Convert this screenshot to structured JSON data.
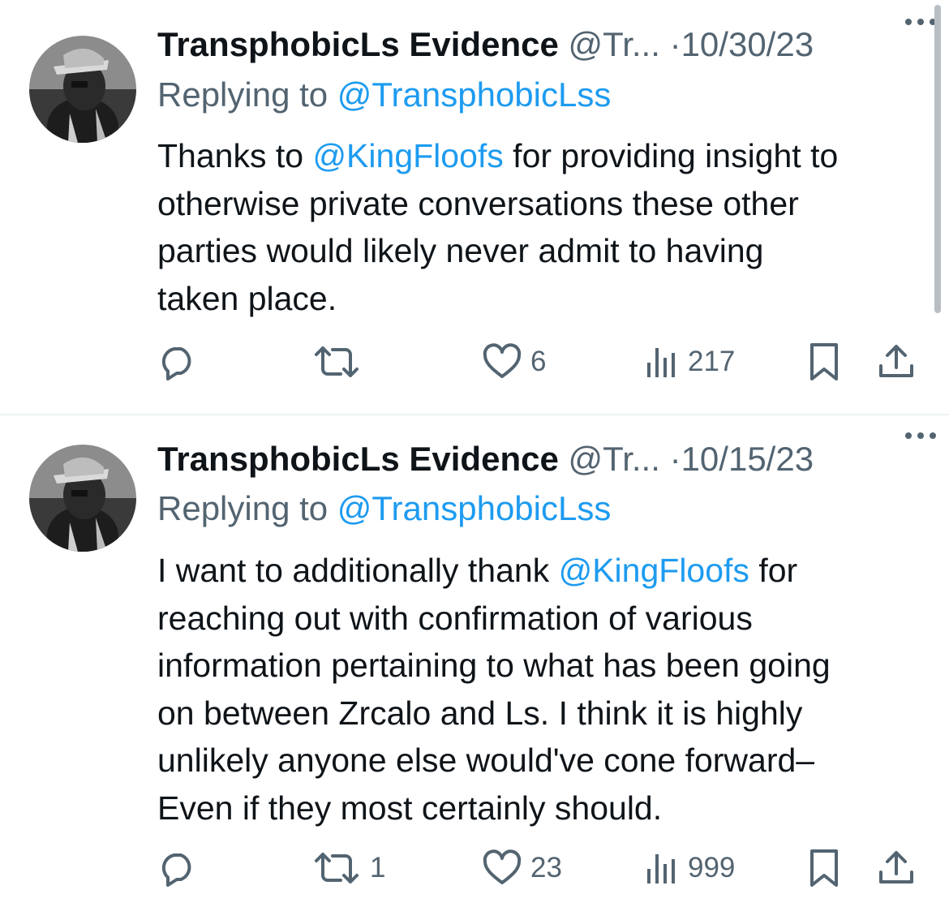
{
  "colors": {
    "text": "#0f1419",
    "secondary": "#536471",
    "link": "#1d9bf0",
    "divider": "#eff3f4"
  },
  "icons": {
    "reply": "speech-bubble-icon",
    "repost": "repost-arrows-icon",
    "like": "heart-icon",
    "views": "bar-chart-icon",
    "bookmark": "bookmark-icon",
    "share": "share-upload-icon",
    "more": "ellipsis-icon"
  },
  "tweets": [
    {
      "author": "TransphobicLs Evidence",
      "handle": "@Tr...",
      "separator": "·",
      "date": "10/30/23",
      "replying_prefix": "Replying to ",
      "replying_to": "@TransphobicLss",
      "lines": [
        [
          {
            "t": "Thanks to "
          },
          {
            "t": "@KingFloofs",
            "m": true
          },
          {
            "t": " for providing insight to"
          }
        ],
        [
          {
            "t": "otherwise private conversations these other"
          }
        ],
        [
          {
            "t": "parties would likely never admit to having"
          }
        ],
        [
          {
            "t": "taken place."
          }
        ]
      ],
      "replies": "",
      "reposts": "",
      "likes": "6",
      "views": "217"
    },
    {
      "author": "TransphobicLs Evidence",
      "handle": "@Tr...",
      "separator": "·",
      "date": "10/15/23",
      "replying_prefix": "Replying to ",
      "replying_to": "@TransphobicLss",
      "lines": [
        [
          {
            "t": "I want to additionally thank "
          },
          {
            "t": "@KingFloofs",
            "m": true
          },
          {
            "t": " for"
          }
        ],
        [
          {
            "t": "reaching out with confirmation of various"
          }
        ],
        [
          {
            "t": "information pertaining to what has been going"
          }
        ],
        [
          {
            "t": "on between Zrcalo and Ls. I think it is highly"
          }
        ],
        [
          {
            "t": "unlikely anyone else would've cone forward–"
          }
        ],
        [
          {
            "t": "Even if they most certainly should."
          }
        ]
      ],
      "replies": "",
      "reposts": "1",
      "likes": "23",
      "views": "999"
    }
  ]
}
